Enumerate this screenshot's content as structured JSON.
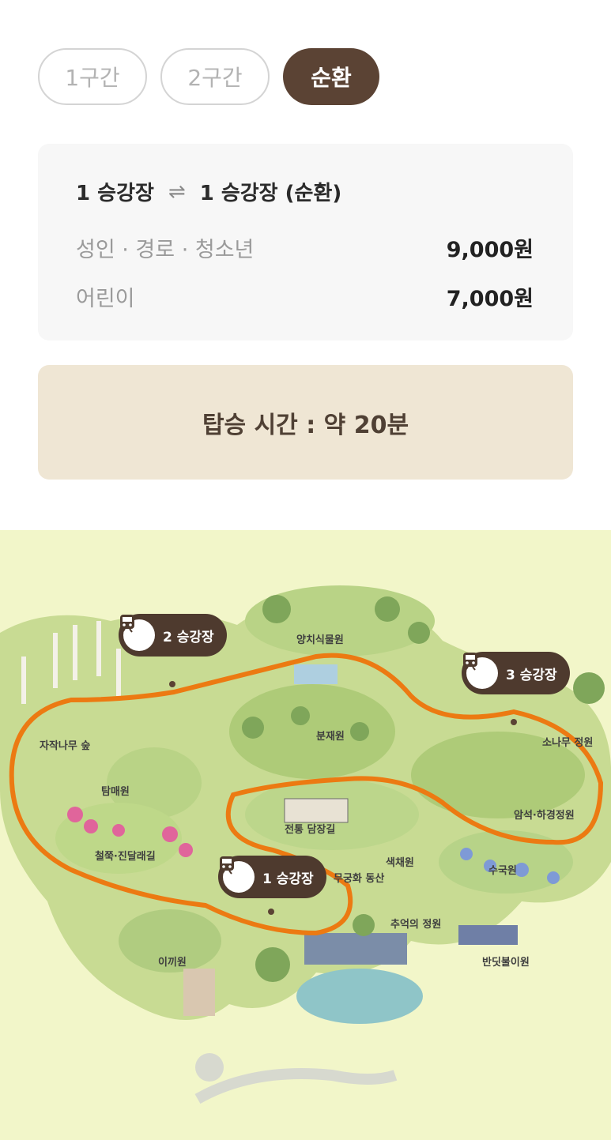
{
  "tabs": [
    {
      "label": "1구간",
      "active": false
    },
    {
      "label": "2구간",
      "active": false
    },
    {
      "label": "순환",
      "active": true
    }
  ],
  "fare": {
    "from": "1 승강장",
    "to": "1 승강장 (순환)",
    "rows": [
      {
        "label": "성인 · 경로 · 청소년",
        "price": "9,000원"
      },
      {
        "label": "어린이",
        "price": "7,000원"
      }
    ]
  },
  "ride_time": "탑승 시간 : 약 20분",
  "map": {
    "stations": [
      {
        "label": "1 승강장",
        "icon": "train-icon"
      },
      {
        "label": "2 승강장",
        "icon": "train-icon"
      },
      {
        "label": "3 승강장",
        "icon": "train-icon"
      }
    ],
    "areas": [
      "양치식물원",
      "분재원",
      "자작나무 숲",
      "탐매원",
      "철쭉·진달래길",
      "이끼원",
      "전통 담장길",
      "색채원",
      "무궁화 동산",
      "수국원",
      "추억의 정원",
      "반딧불이원",
      "암석·하경정원",
      "소나무 정원"
    ],
    "route_color": "#ec7a12"
  }
}
